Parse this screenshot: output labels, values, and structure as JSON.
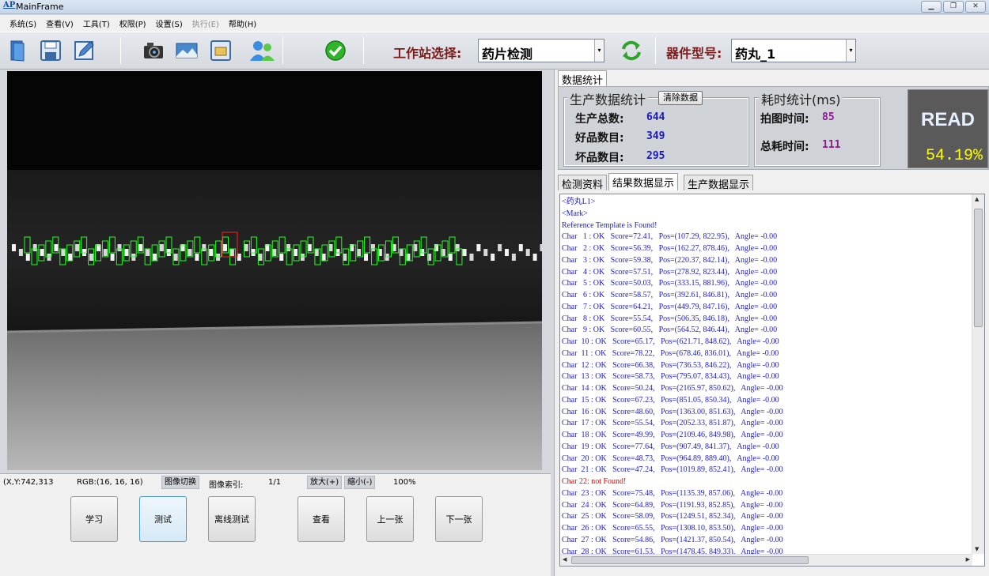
{
  "window": {
    "title": "MainFrame",
    "icon_text": "AP"
  },
  "menu": [
    {
      "label": "系统(S)",
      "enabled": true
    },
    {
      "label": "查看(V)",
      "enabled": true
    },
    {
      "label": "工具(T)",
      "enabled": true
    },
    {
      "label": "权限(P)",
      "enabled": true
    },
    {
      "label": "设置(S)",
      "enabled": true
    },
    {
      "label": "执行(E)",
      "enabled": false
    },
    {
      "label": "帮助(H)",
      "enabled": true
    }
  ],
  "toolbar": {
    "station_label": "工作站选择:",
    "station_value": "药片检测",
    "part_label": "器件型号:",
    "part_value": "药丸_1"
  },
  "status": {
    "coords": "(X,Y:742,313",
    "rgb": "RGB:(16, 16, 16)",
    "switch_btn": "图像切换",
    "index_label": "图像索引:",
    "index_value": "1/1",
    "zoom_in": "放大(+)",
    "zoom_out": "缩小(-)",
    "zoom_level": "100%"
  },
  "actions": [
    {
      "label": "学习"
    },
    {
      "label": "测试"
    },
    {
      "label": "离线测试"
    },
    {
      "label": "查看"
    },
    {
      "label": "上一张"
    },
    {
      "label": "下一张"
    }
  ],
  "right_tabs": {
    "stats_tab": "数据统计"
  },
  "production": {
    "title": "生产数据统计",
    "clear_btn": "清除数据",
    "total_label": "生产总数:",
    "total": "644",
    "good_label": "好品数目:",
    "good": "349",
    "bad_label": "坏品数目:",
    "bad": "295"
  },
  "timing": {
    "title": "耗时统计(ms)",
    "capture_label": "拍图时间:",
    "capture": "85",
    "total_label": "总耗时间:",
    "total": "111"
  },
  "read": {
    "label": "READ",
    "percent": "54.19%"
  },
  "lower_tabs": [
    {
      "label": "检测资料"
    },
    {
      "label": "结果数据显示"
    },
    {
      "label": "生产数据显示"
    }
  ],
  "log": [
    "<药丸L1>",
    "<Mark>",
    "Reference Template is Found!",
    "Char   1 : OK   Score=72.41,   Pos=(107.29, 822.95),   Angle= -0.00",
    "Char   2 : OK   Score=56.39,   Pos=(162.27, 878.46),   Angle= -0.00",
    "Char   3 : OK   Score=59.38,   Pos=(220.37, 842.14),   Angle= -0.00",
    "Char   4 : OK   Score=57.51,   Pos=(278.92, 823.44),   Angle= -0.00",
    "Char   5 : OK   Score=50.03,   Pos=(333.15, 881.96),   Angle= -0.00",
    "Char   6 : OK   Score=58.57,   Pos=(392.61, 846.81),   Angle= -0.00",
    "Char   7 : OK   Score=64.21,   Pos=(449.79, 847.16),   Angle= -0.00",
    "Char   8 : OK   Score=55.54,   Pos=(506.35, 846.18),   Angle= -0.00",
    "Char   9 : OK   Score=60.55,   Pos=(564.52, 846.44),   Angle= -0.00",
    "Char  10 : OK   Score=65.17,   Pos=(621.71, 848.62),   Angle= -0.00",
    "Char  11 : OK   Score=78.22,   Pos=(678.46, 836.01),   Angle= -0.00",
    "Char  12 : OK   Score=66.38,   Pos=(736.53, 846.22),   Angle= -0.00",
    "Char  13 : OK   Score=58.73,   Pos=(795.07, 834.43),   Angle= -0.00",
    "Char  14 : OK   Score=50.24,   Pos=(2165.97, 850.62),   Angle= -0.00",
    "Char  15 : OK   Score=67.23,   Pos=(851.05, 850.34),   Angle= -0.00",
    "Char  16 : OK   Score=48.60,   Pos=(1363.00, 851.63),   Angle= -0.00",
    "Char  17 : OK   Score=55.54,   Pos=(2052.33, 851.87),   Angle= -0.00",
    "Char  18 : OK   Score=49.99,   Pos=(2109.46, 849.98),   Angle= -0.00",
    "Char  19 : OK   Score=77.64,   Pos=(907.49, 841.37),   Angle= -0.00",
    "Char  20 : OK   Score=48.73,   Pos=(964.89, 889.40),   Angle= -0.00",
    "Char  21 : OK   Score=47.24,   Pos=(1019.89, 852.41),   Angle= -0.00",
    "Char 22: not Found!",
    "Char  23 : OK   Score=75.48,   Pos=(1135.39, 857.06),   Angle= -0.00",
    "Char  24 : OK   Score=64.89,   Pos=(1191.93, 852.85),   Angle= -0.00",
    "Char  25 : OK   Score=58.09,   Pos=(1249.51, 852.34),   Angle= -0.00",
    "Char  26 : OK   Score=65.55,   Pos=(1308.10, 853.50),   Angle= -0.00",
    "Char  27 : OK   Score=54.86,   Pos=(1421.37, 850.54),   Angle= -0.00",
    "Char  28 : OK   Score=61.53,   Pos=(1478.45, 849.33),   Angle= -0.00"
  ],
  "colors": {
    "log_text": "#1c1ccc",
    "log_error": "#e00000",
    "detect_ok": "#22ff22",
    "detect_fail": "#ff2020",
    "read_percent": "#ffff00"
  }
}
